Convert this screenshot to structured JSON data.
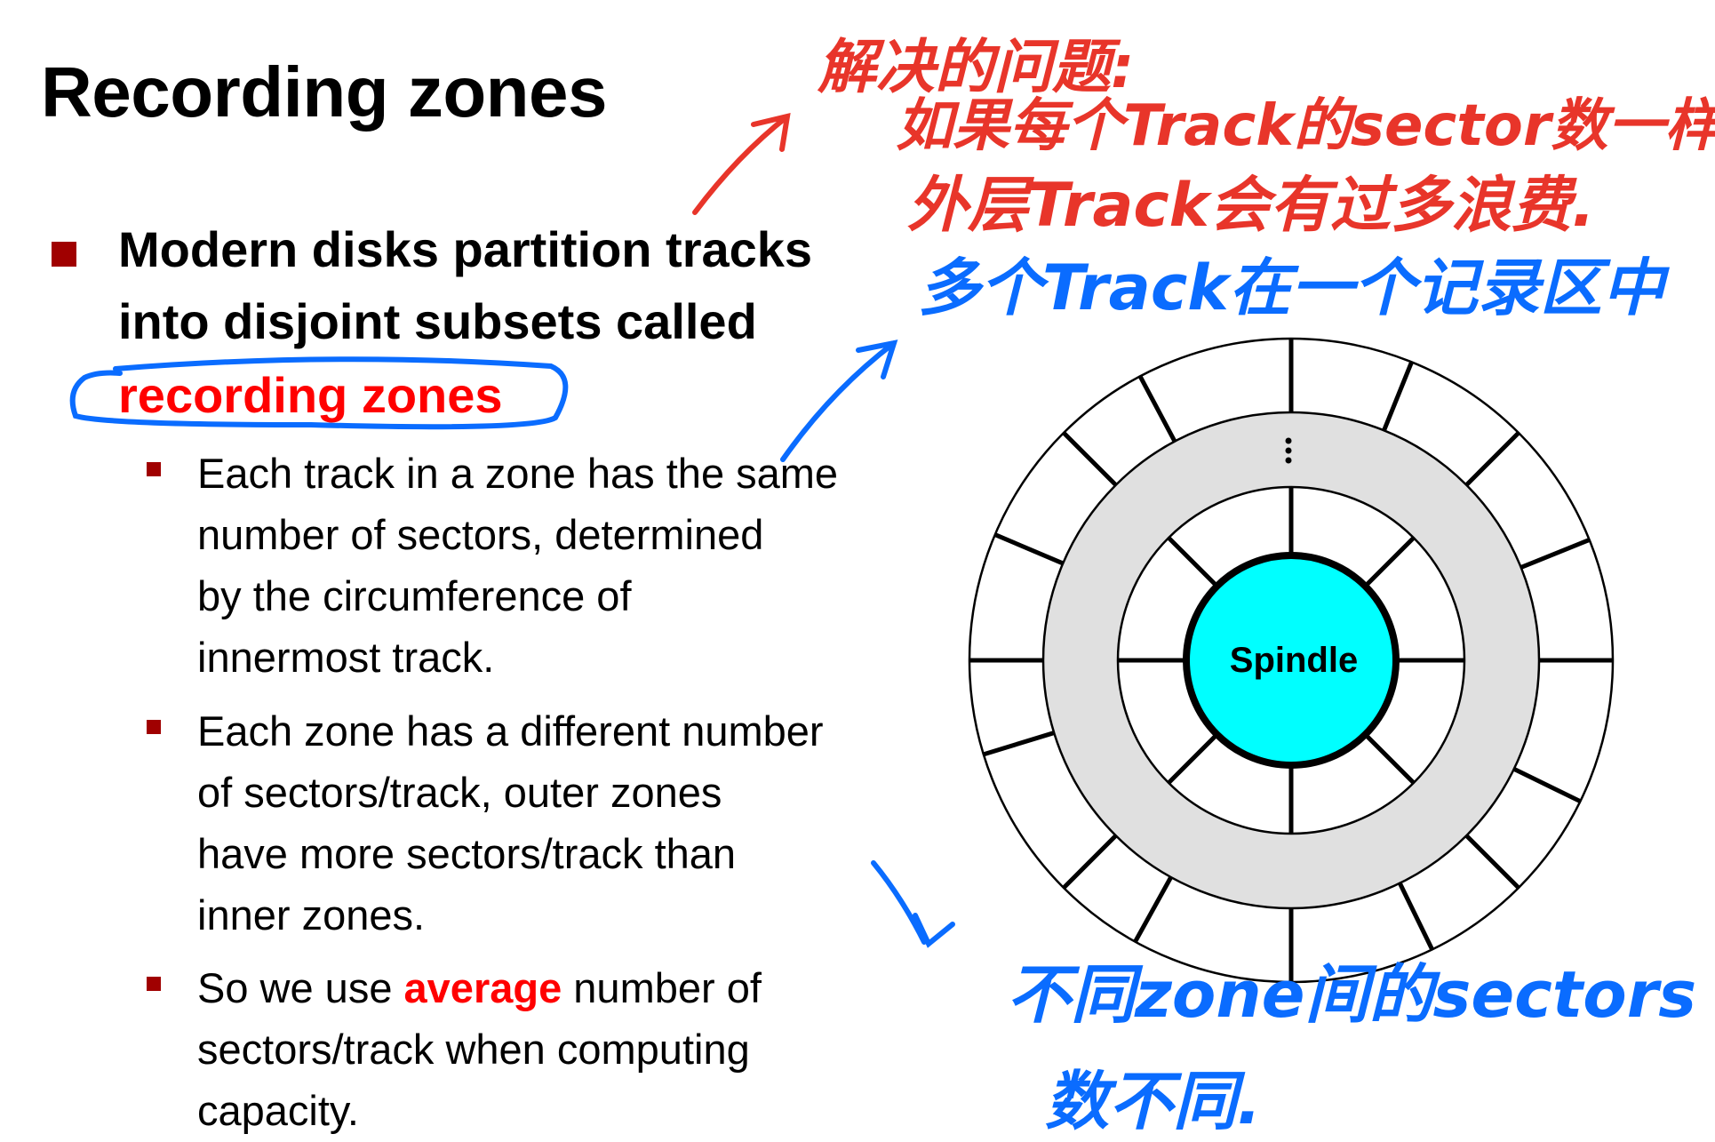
{
  "slide": {
    "title": "Recording zones",
    "bullet": {
      "line1": "Modern disks partition tracks",
      "line2": "into disjoint subsets called",
      "highlight": "recording zones"
    },
    "sub_bullets": [
      {
        "lines": [
          "Each track in a zone has the same",
          "number of sectors, determined",
          "by the circumference of",
          "innermost track."
        ]
      },
      {
        "lines": [
          "Each zone has a different number",
          "of sectors/track, outer zones",
          "have more sectors/track than",
          "inner zones."
        ]
      },
      {
        "prefix": "So we use ",
        "emph": "average",
        "suffix": " number of",
        "lines": [
          "sectors/track when computing",
          "capacity."
        ]
      }
    ],
    "diagram": {
      "center_label": "Spindle",
      "ellipsis": "⋮",
      "colors": {
        "spindle": "#00ffff",
        "middle_zone": "#e0e0e0"
      }
    }
  },
  "annotations": {
    "red": [
      "解决的问题:",
      "如果每个Track的sector数一样,",
      "外层Track会有过多浪费."
    ],
    "blue_top": "多个Track在一个记录区中",
    "blue_bottom": [
      "不同zone间的sectors",
      "数不同."
    ],
    "colors": {
      "red": "#e8352a",
      "blue": "#0a6cff"
    }
  }
}
